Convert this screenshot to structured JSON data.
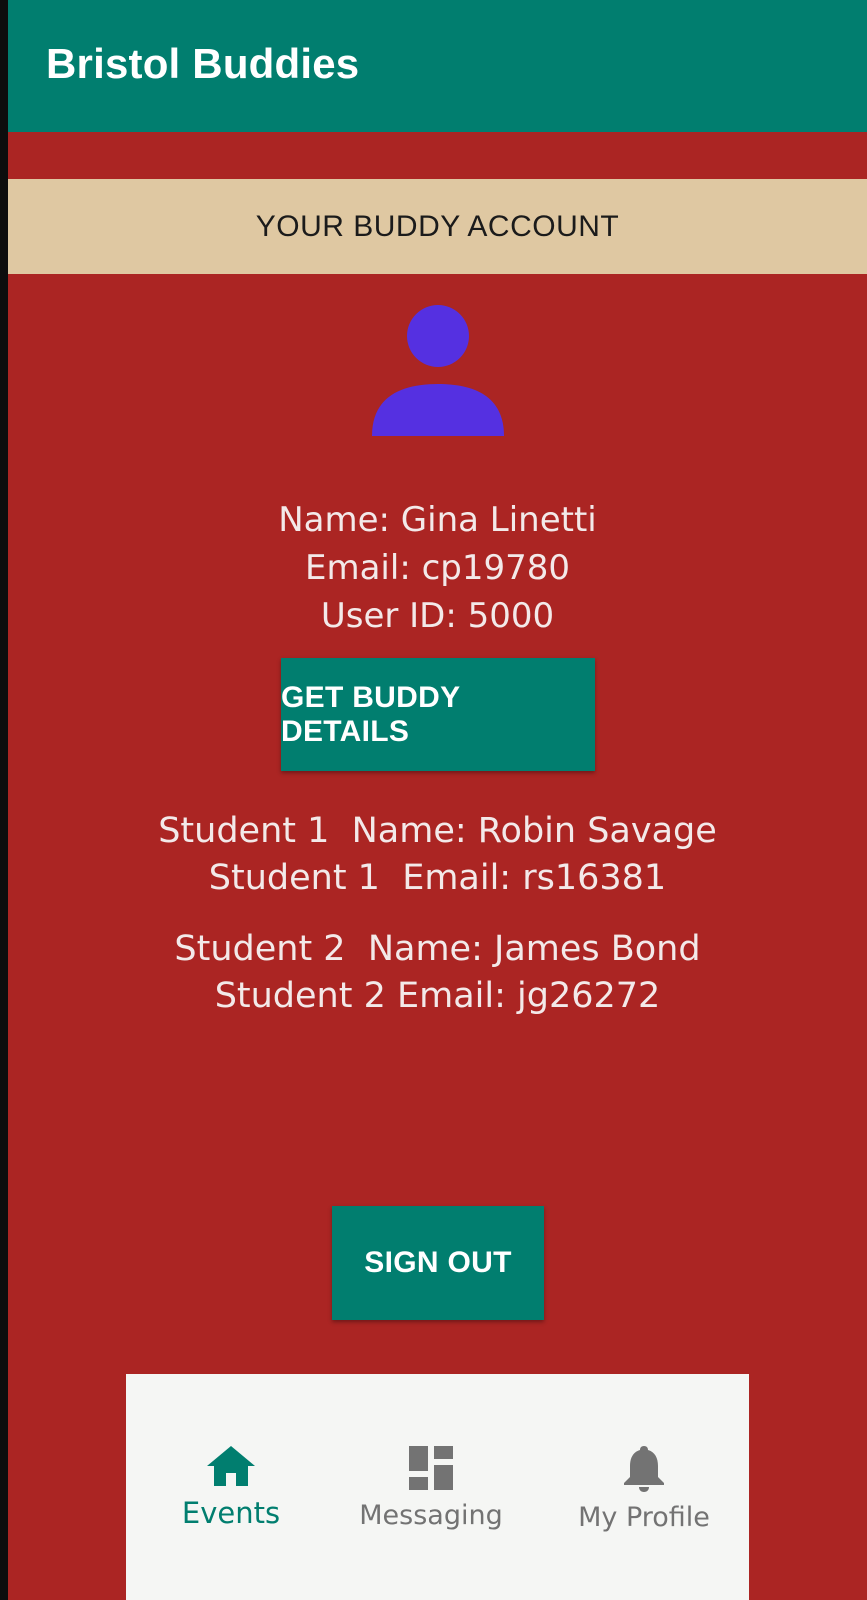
{
  "app": {
    "title": "Bristol Buddies"
  },
  "banner": {
    "label": "YOUR BUDDY ACCOUNT"
  },
  "avatar": {
    "icon": "person-icon",
    "color": "#5530e1"
  },
  "user": {
    "name_line": "Name: Gina Linetti",
    "email_line": "Email: cp19780",
    "id_line": "User ID: 5000"
  },
  "buttons": {
    "buddy_details": "GET BUDDY DETAILS",
    "sign_out": "SIGN OUT"
  },
  "students": [
    {
      "name_line": "Student 1  Name: Robin Savage",
      "email_line": "Student 1  Email: rs16381"
    },
    {
      "name_line": "Student 2  Name: James Bond",
      "email_line": "Student 2 Email: jg26272"
    }
  ],
  "bottom_nav": {
    "items": [
      {
        "label": "Events",
        "icon": "home-icon",
        "active": true
      },
      {
        "label": "Messaging",
        "icon": "dashboard-icon",
        "active": false
      },
      {
        "label": "My Profile",
        "icon": "bell-icon",
        "active": false
      }
    ]
  },
  "colors": {
    "primary": "#017e6f",
    "background": "#ab2523",
    "banner": "#dfc8a2",
    "nav_background": "#f5f6f4"
  }
}
